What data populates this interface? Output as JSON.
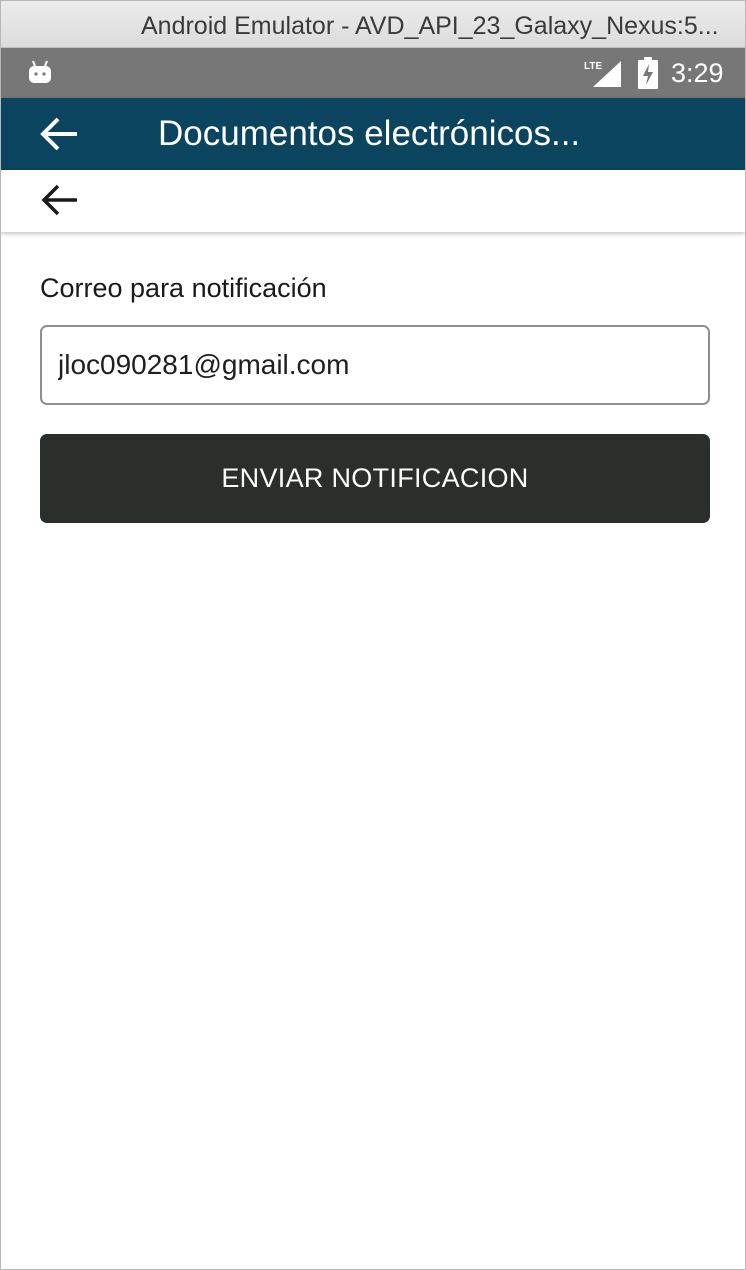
{
  "window": {
    "title": "Android Emulator - AVD_API_23_Galaxy_Nexus:5..."
  },
  "status_bar": {
    "network": "LTE",
    "time": "3:29",
    "icons": [
      "android-debug-icon",
      "lte-signal-icon",
      "battery-charging-icon"
    ]
  },
  "app_bar": {
    "title": "Documentos electrónicos...",
    "back_icon": "arrow-back-icon",
    "background_color": "#0a445f"
  },
  "sub_bar": {
    "back_icon": "arrow-back-icon"
  },
  "form": {
    "email_label": "Correo para notificación",
    "email_value": "jloc090281@gmail.com",
    "send_button_label": "ENVIAR NOTIFICACION",
    "button_color": "#2b2f2c"
  }
}
